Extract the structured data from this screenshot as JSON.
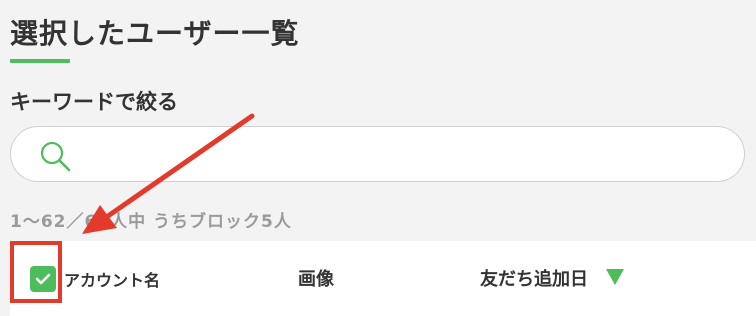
{
  "page": {
    "title": "選択したユーザー一覧",
    "accent_color": "#4cbd5a"
  },
  "search": {
    "label": "キーワードで絞る",
    "value": "",
    "placeholder": "",
    "icon": "search-icon"
  },
  "results": {
    "count_text": "1～62／62人中 うちブロック5人"
  },
  "table": {
    "select_all_checked": true,
    "columns": [
      {
        "label": "アカウント名"
      },
      {
        "label": "画像"
      },
      {
        "label": "友だち追加日",
        "sort": "descending",
        "sort_icon": "triangle-down-icon"
      }
    ]
  },
  "annotation": {
    "highlight_color": "#e23b2c"
  }
}
